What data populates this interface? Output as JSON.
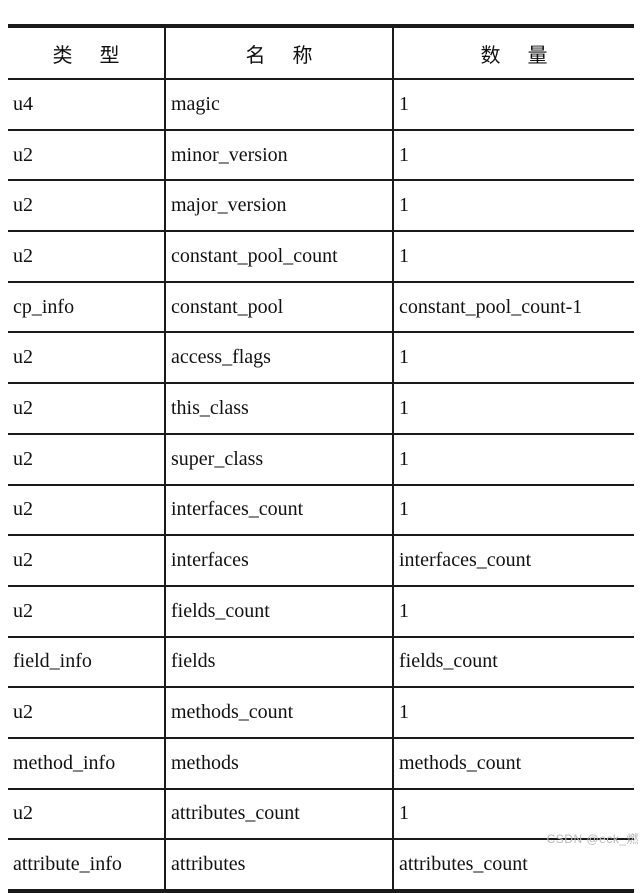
{
  "table": {
    "headers": [
      "类 型",
      "名 称",
      "数 量"
    ],
    "rows": [
      {
        "type": "u4",
        "name": "magic",
        "count": "1"
      },
      {
        "type": "u2",
        "name": "minor_version",
        "count": "1"
      },
      {
        "type": "u2",
        "name": "major_version",
        "count": "1"
      },
      {
        "type": "u2",
        "name": "constant_pool_count",
        "count": "1"
      },
      {
        "type": "cp_info",
        "name": "constant_pool",
        "count": "constant_pool_count-1"
      },
      {
        "type": "u2",
        "name": "access_flags",
        "count": "1"
      },
      {
        "type": "u2",
        "name": "this_class",
        "count": "1"
      },
      {
        "type": "u2",
        "name": "super_class",
        "count": "1"
      },
      {
        "type": "u2",
        "name": "interfaces_count",
        "count": "1"
      },
      {
        "type": "u2",
        "name": "interfaces",
        "count": "interfaces_count"
      },
      {
        "type": "u2",
        "name": "fields_count",
        "count": "1"
      },
      {
        "type": "field_info",
        "name": "fields",
        "count": "fields_count"
      },
      {
        "type": "u2",
        "name": "methods_count",
        "count": "1"
      },
      {
        "type": "method_info",
        "name": "methods",
        "count": "methods_count"
      },
      {
        "type": "u2",
        "name": "attributes_count",
        "count": "1"
      },
      {
        "type": "attribute_info",
        "name": "attributes",
        "count": "attributes_count"
      }
    ]
  },
  "watermark": {
    "text": "CSDN @eck_燃"
  },
  "colors": {
    "border": "#1a1a1a",
    "text": "#111111",
    "background": "#ffffff",
    "watermark": "#b9b9b9"
  }
}
